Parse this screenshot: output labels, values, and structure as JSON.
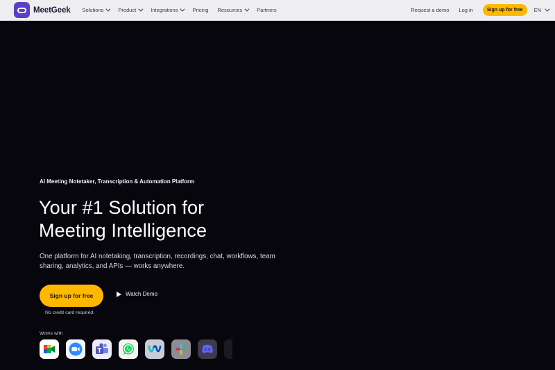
{
  "brand": {
    "name": "MeetGeek",
    "color": "#5b3fc4"
  },
  "nav": {
    "items": [
      {
        "label": "Solutions",
        "dropdown": true
      },
      {
        "label": "Product",
        "dropdown": true
      },
      {
        "label": "Integrations",
        "dropdown": true
      },
      {
        "label": "Pricing",
        "dropdown": false
      },
      {
        "label": "Resources",
        "dropdown": true
      },
      {
        "label": "Partners",
        "dropdown": false
      }
    ],
    "request_demo": "Request a demo",
    "login": "Log in",
    "signup": "Sign up for free",
    "language": "EN"
  },
  "hero": {
    "eyebrow": "AI Meeting Notetaker, Transcription & Automation Platform",
    "headline_line1": "Your #1 Solution for",
    "headline_line2": "Meeting Intelligence",
    "subtitle": "One platform for AI notetaking, transcription, recordings, chat, workflows, team sharing, analytics, and APIs — works anywhere.",
    "cta": "Sign up for free",
    "watch_demo": "Watch Demo",
    "no_cc": "No credit card required.",
    "works_with": "Works with"
  },
  "integrations": [
    {
      "icon": "google-meet-icon"
    },
    {
      "icon": "zoom-icon"
    },
    {
      "icon": "microsoft-teams-icon"
    },
    {
      "icon": "whatsapp-icon"
    },
    {
      "icon": "webex-icon"
    },
    {
      "icon": "slack-icon"
    },
    {
      "icon": "discord-icon"
    },
    {
      "icon": "more-integration-icon"
    }
  ],
  "colors": {
    "accent": "#ffb800",
    "background": "#07060d"
  }
}
